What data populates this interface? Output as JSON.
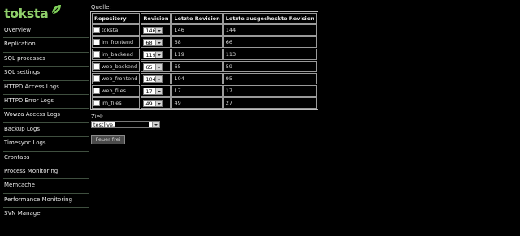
{
  "logo": {
    "text": "toksta"
  },
  "sidebar": {
    "items": [
      {
        "label": "Overview"
      },
      {
        "label": "Replication"
      },
      {
        "label": "SQL processes"
      },
      {
        "label": "SQL settings"
      },
      {
        "label": "HTTPD Access Logs"
      },
      {
        "label": "HTTPD Error Logs"
      },
      {
        "label": "Wowza Access Logs"
      },
      {
        "label": "Backup Logs"
      },
      {
        "label": "Timesync Logs"
      },
      {
        "label": "Crontabs"
      },
      {
        "label": "Process Monitoring"
      },
      {
        "label": "Memcache"
      },
      {
        "label": "Performance Monitoring"
      },
      {
        "label": "SVN Manager"
      }
    ]
  },
  "main": {
    "source_label": "Quelle:",
    "table": {
      "headers": [
        "Repository",
        "Revision",
        "Letzte Revision",
        "Letzte ausgecheckte Revision"
      ],
      "rows": [
        {
          "name": "toksta",
          "revision": "146",
          "last": "146",
          "checked_out": "144"
        },
        {
          "name": "im_frontend",
          "revision": "68",
          "last": "68",
          "checked_out": "66"
        },
        {
          "name": "im_backend",
          "revision": "119",
          "last": "119",
          "checked_out": "113"
        },
        {
          "name": "web_backend",
          "revision": "65",
          "last": "65",
          "checked_out": "59"
        },
        {
          "name": "web_frontend",
          "revision": "104",
          "last": "104",
          "checked_out": "95"
        },
        {
          "name": "web_files",
          "revision": "17",
          "last": "17",
          "checked_out": "17"
        },
        {
          "name": "im_files",
          "revision": "49",
          "last": "49",
          "checked_out": "27"
        }
      ]
    },
    "target_label": "Ziel:",
    "target_value": "testlive.",
    "fire_button": "Feuer frei"
  }
}
